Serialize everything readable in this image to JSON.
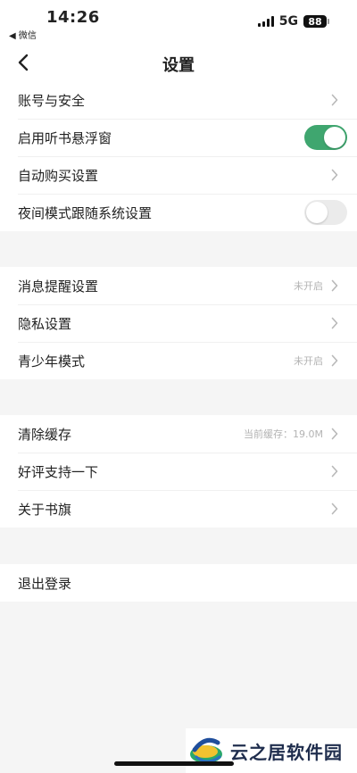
{
  "status_bar": {
    "time": "14:26",
    "back_app": "◀ 微信",
    "network": "5G",
    "battery": "88"
  },
  "nav": {
    "title": "设置"
  },
  "groups": [
    {
      "items": [
        {
          "label": "账号与安全",
          "type": "arrow"
        },
        {
          "label": "启用听书悬浮窗",
          "type": "toggle",
          "on": true
        },
        {
          "label": "自动购买设置",
          "type": "arrow"
        },
        {
          "label": "夜间模式跟随系统设置",
          "type": "toggle",
          "on": false
        }
      ]
    },
    {
      "items": [
        {
          "label": "消息提醒设置",
          "type": "arrow",
          "value": "未开启"
        },
        {
          "label": "隐私设置",
          "type": "arrow"
        },
        {
          "label": "青少年模式",
          "type": "arrow",
          "value": "未开启"
        }
      ]
    },
    {
      "items": [
        {
          "label": "清除缓存",
          "type": "arrow",
          "value": "当前缓存：19.0M"
        },
        {
          "label": "好评支持一下",
          "type": "arrow"
        },
        {
          "label": "关于书旗",
          "type": "arrow"
        }
      ]
    },
    {
      "items": [
        {
          "label": "退出登录",
          "type": "plain"
        }
      ]
    }
  ],
  "watermark": {
    "text": "云之居软件园"
  },
  "colors": {
    "toggle_on": "#3fa66f",
    "toggle_off": "#ebebeb",
    "page_bg": "#f5f5f5",
    "value_text": "#b3b3b3"
  }
}
